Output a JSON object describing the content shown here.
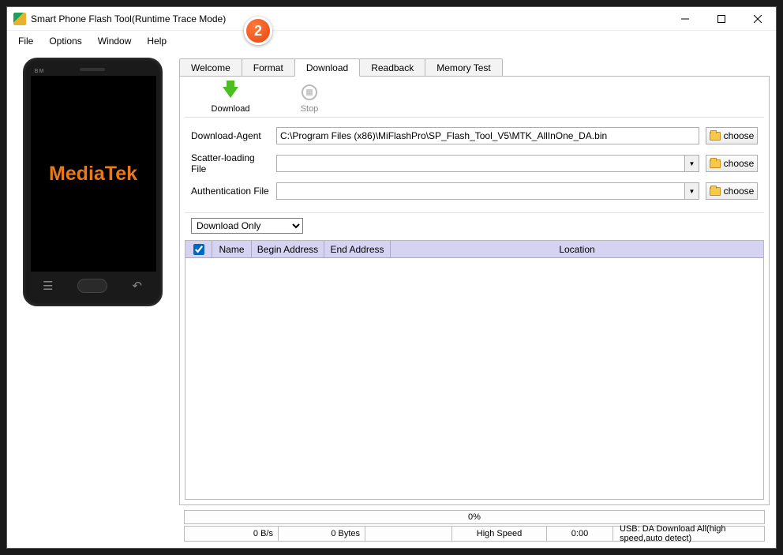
{
  "title": "Smart Phone Flash Tool(Runtime Trace Mode)",
  "badge": "2",
  "menu": {
    "file": "File",
    "options": "Options",
    "window": "Window",
    "help": "Help"
  },
  "phone": {
    "bm": "BM",
    "logo": "MediaTek"
  },
  "tabs": {
    "welcome": "Welcome",
    "format": "Format",
    "download": "Download",
    "readback": "Readback",
    "memtest": "Memory Test"
  },
  "toolbar": {
    "download": "Download",
    "stop": "Stop"
  },
  "form": {
    "da_label": "Download-Agent",
    "da_value": "C:\\Program Files (x86)\\MiFlashPro\\SP_Flash_Tool_V5\\MTK_AllInOne_DA.bin",
    "scatter_label": "Scatter-loading File",
    "scatter_value": "",
    "auth_label": "Authentication File",
    "auth_value": "",
    "choose": "choose",
    "mode": "Download Only"
  },
  "table": {
    "name": "Name",
    "begin": "Begin Address",
    "end": "End Address",
    "loc": "Location"
  },
  "status": {
    "progress": "0%",
    "speed": "0 B/s",
    "bytes": "0 Bytes",
    "blank": "",
    "mode": "High Speed",
    "time": "0:00",
    "usb": "USB: DA Download All(high speed,auto detect)"
  }
}
